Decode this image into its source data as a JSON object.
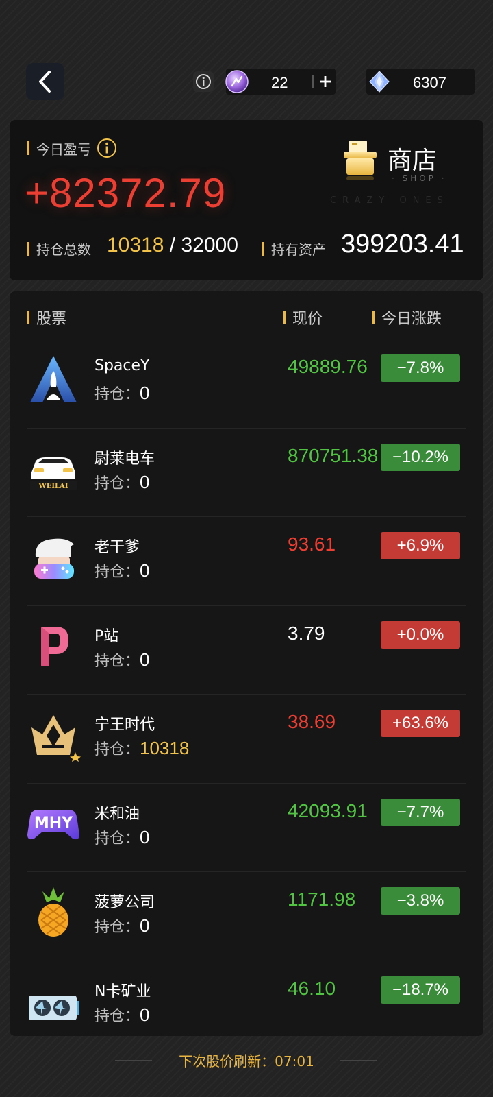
{
  "header": {
    "energy_value": "22",
    "gem_value": "6307",
    "icons": [
      "back-arrow-icon",
      "info-icon",
      "energy-orb-icon",
      "plus-icon",
      "diamond-icon"
    ]
  },
  "summary": {
    "today_label": "今日盈亏",
    "today_value": "+82372.79",
    "holdings_label": "持仓总数",
    "holdings_current": "10318",
    "holdings_total": "32000",
    "assets_label": "持有资产",
    "assets_value": "399203.41",
    "shop_label": "商店",
    "shop_sub": "· SHOP ·",
    "watermark": "CRAZY ONES"
  },
  "list": {
    "col_stock": "股票",
    "col_price": "现价",
    "col_change": "今日涨跌",
    "hold_prefix": "持仓：",
    "stocks": [
      {
        "name": "SpaceY",
        "holding": "0",
        "price": "49889.76",
        "change": "−7.8%",
        "trend": "down",
        "logo": "rocket-logo"
      },
      {
        "name": "尉莱电车",
        "holding": "0",
        "price": "870751.38",
        "change": "−10.2%",
        "trend": "down",
        "logo": "car-logo",
        "logo_text": "WEILAI"
      },
      {
        "name": "老干爹",
        "holding": "0",
        "price": "93.61",
        "change": "+6.9%",
        "trend": "up",
        "logo": "gamer-logo"
      },
      {
        "name": "P站",
        "holding": "0",
        "price": "3.79",
        "change": "+0.0%",
        "trend": "up",
        "price_trend": "flat",
        "logo": "p-logo"
      },
      {
        "name": "宁王时代",
        "holding": "10318",
        "price": "38.69",
        "change": "+63.6%",
        "trend": "up",
        "logo": "crown-logo"
      },
      {
        "name": "米和油",
        "holding": "0",
        "price": "42093.91",
        "change": "−7.7%",
        "trend": "down",
        "logo": "mhy-logo",
        "logo_text": "MHY"
      },
      {
        "name": "菠萝公司",
        "holding": "0",
        "price": "1171.98",
        "change": "−3.8%",
        "trend": "down",
        "logo": "pineapple-logo"
      },
      {
        "name": "N卡矿业",
        "holding": "0",
        "price": "46.10",
        "change": "−18.7%",
        "trend": "down",
        "logo": "gpu-logo"
      }
    ]
  },
  "footer": {
    "refresh_text": "下次股价刷新：07:01"
  },
  "colors": {
    "up": "#ec3f34",
    "down": "#52c443",
    "accent": "#f1c34a",
    "up_badge": "#c43b35",
    "down_badge": "#3a8c3a"
  }
}
